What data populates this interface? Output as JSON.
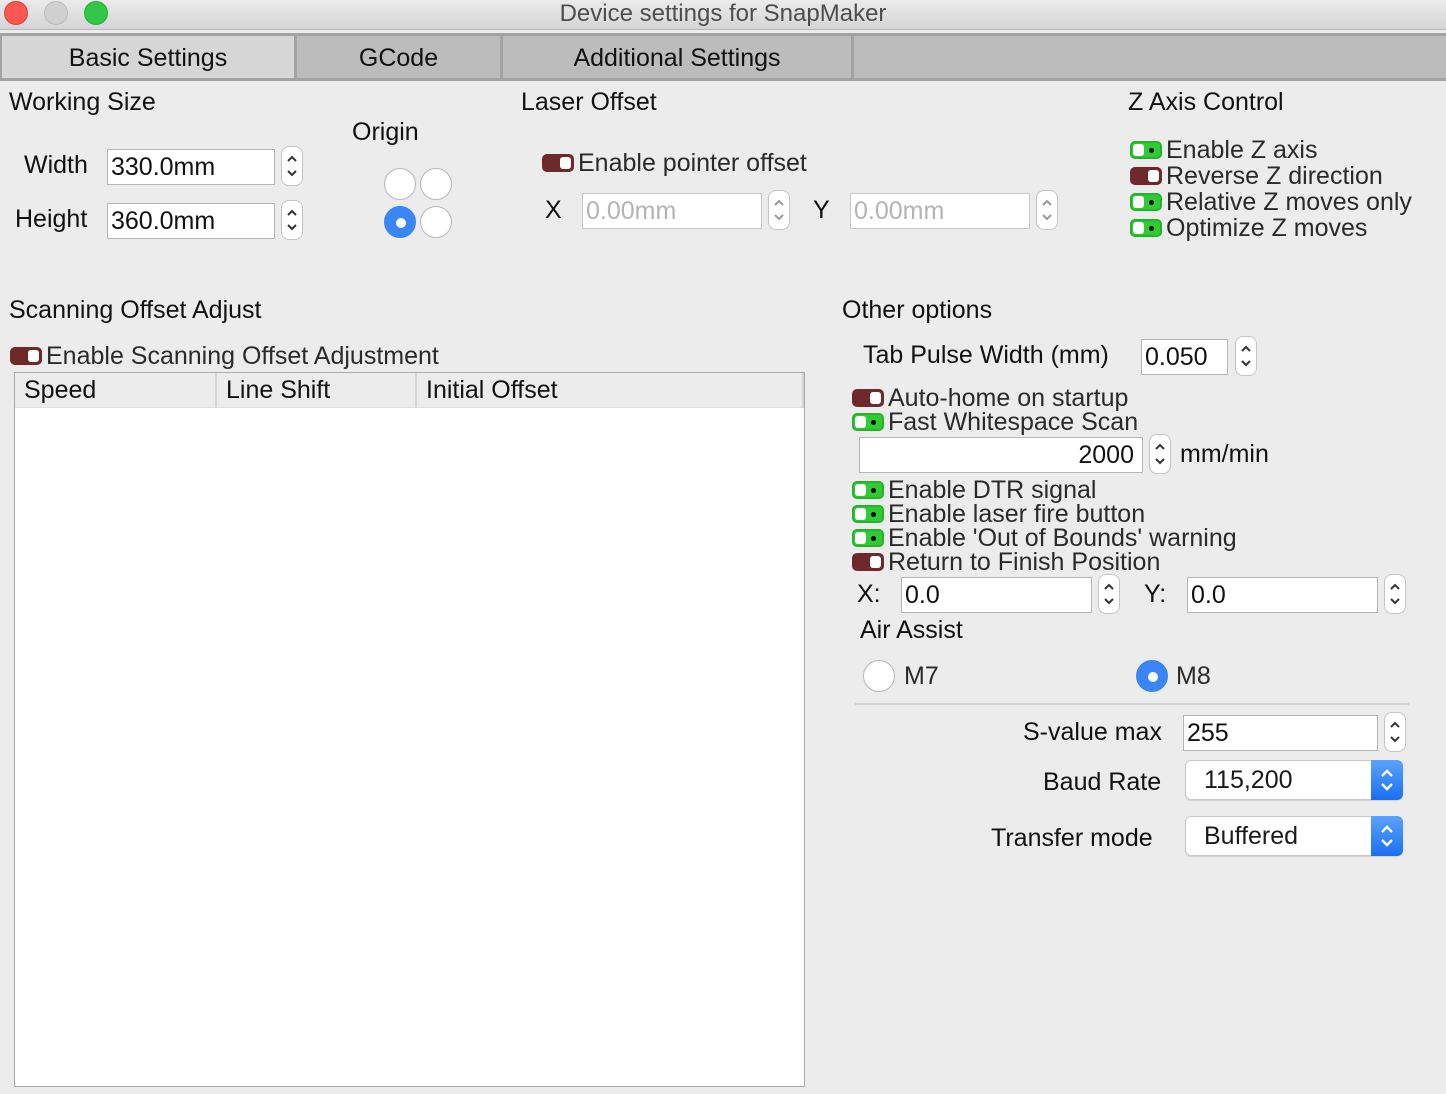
{
  "window": {
    "title": "Device settings for SnapMaker",
    "buttons": [
      "close",
      "minimize",
      "zoom"
    ]
  },
  "tabs": [
    {
      "label": "Basic Settings",
      "active": true
    },
    {
      "label": "GCode",
      "active": false
    },
    {
      "label": "Additional Settings",
      "active": false
    }
  ],
  "working_size": {
    "title": "Working Size",
    "width_label": "Width",
    "width_value": "330.0mm",
    "height_label": "Height",
    "height_value": "360.0mm"
  },
  "origin": {
    "title": "Origin",
    "options": [
      "top-left",
      "top-right",
      "bottom-left",
      "bottom-right"
    ],
    "selected": "bottom-left"
  },
  "laser_offset": {
    "title": "Laser Offset",
    "enable_label": "Enable pointer offset",
    "enabled": false,
    "x_label": "X",
    "x_value": "0.00mm",
    "y_label": "Y",
    "y_value": "0.00mm"
  },
  "z_axis": {
    "title": "Z Axis Control",
    "options": [
      {
        "label": "Enable Z axis",
        "on": true
      },
      {
        "label": "Reverse Z direction",
        "on": false
      },
      {
        "label": "Relative Z moves only",
        "on": true
      },
      {
        "label": "Optimize Z moves",
        "on": true
      }
    ]
  },
  "scanning": {
    "title": "Scanning Offset Adjust",
    "enable_label": "Enable Scanning Offset Adjustment",
    "enabled": false,
    "columns": [
      "Speed",
      "Line Shift",
      "Initial Offset"
    ],
    "rows": []
  },
  "other": {
    "title": "Other options",
    "tab_pulse_label": "Tab Pulse Width (mm)",
    "tab_pulse_value": "0.050",
    "auto_home_label": "Auto-home on startup",
    "auto_home": false,
    "fast_scan_label": "Fast Whitespace Scan",
    "fast_scan": true,
    "fast_scan_speed": "2000",
    "fast_scan_unit": "mm/min",
    "dtr_label": "Enable DTR signal",
    "dtr": true,
    "fire_button_label": "Enable laser fire button",
    "fire_button": true,
    "oob_label": "Enable 'Out of Bounds' warning",
    "oob": true,
    "return_label": "Return to Finish Position",
    "return": false,
    "return_x_label": "X:",
    "return_x": "0.0",
    "return_y_label": "Y:",
    "return_y": "0.0",
    "air_assist_title": "Air Assist",
    "air_assist_options": [
      "M7",
      "M8"
    ],
    "air_assist_selected": "M8",
    "s_value_label": "S-value max",
    "s_value": "255",
    "baud_label": "Baud Rate",
    "baud_value": "115,200",
    "transfer_label": "Transfer mode",
    "transfer_value": "Buffered"
  },
  "colors": {
    "toggle_on": "#2ecb34",
    "toggle_off": "#6e2a2a",
    "accent": "#3a86f7",
    "background": "#ececec"
  }
}
